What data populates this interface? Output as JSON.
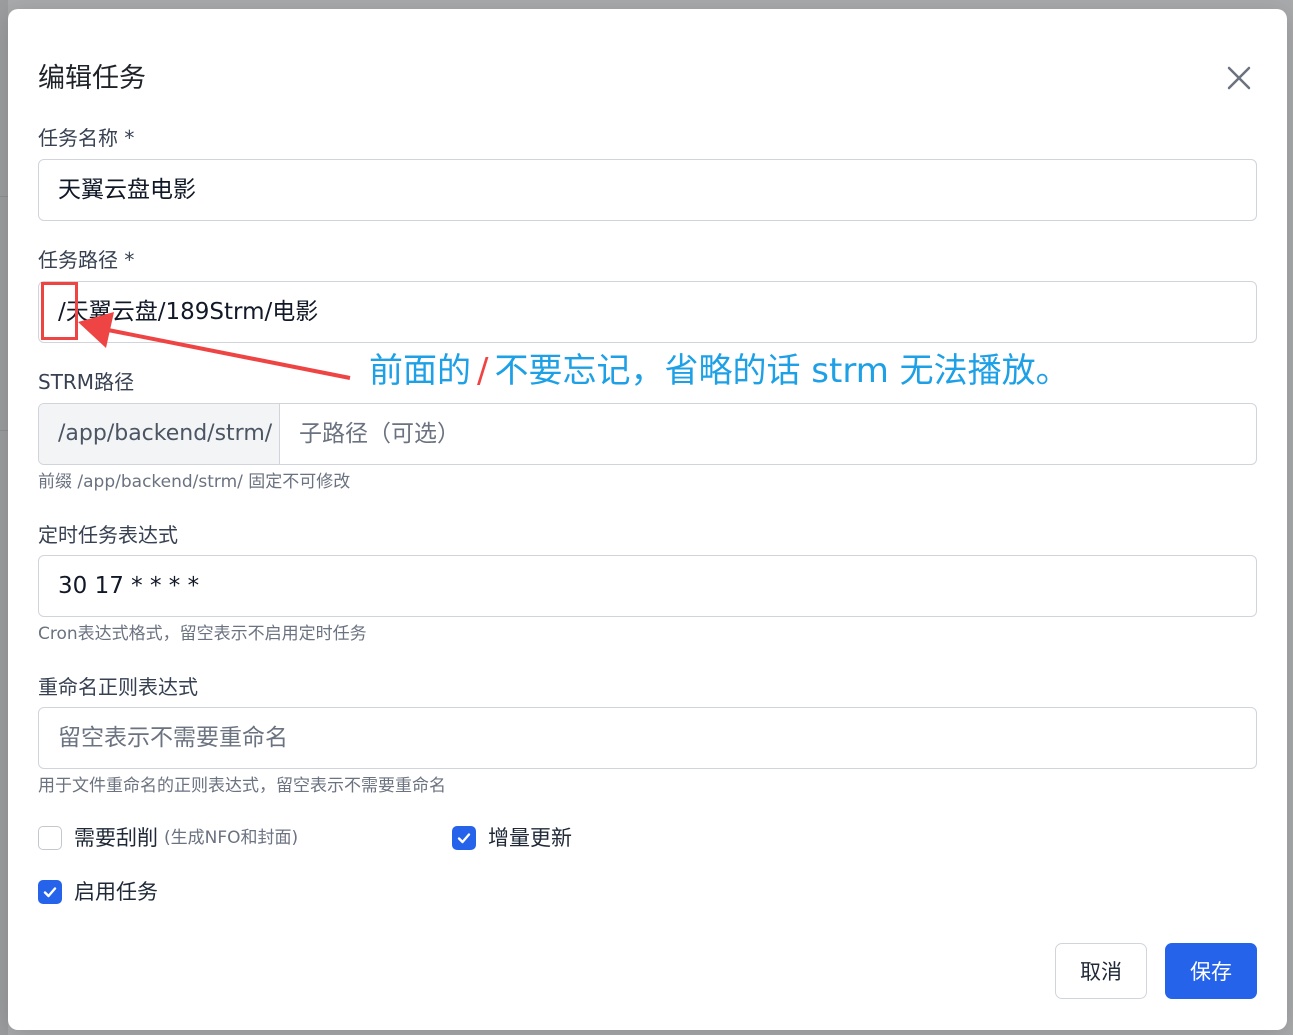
{
  "dialog": {
    "title": "编辑任务"
  },
  "fields": {
    "task_name": {
      "label": "任务名称",
      "required_mark": "*",
      "value": "天翼云盘电影"
    },
    "task_path": {
      "label": "任务路径",
      "required_mark": "*",
      "value": "/天翼云盘/189Strm/电影"
    },
    "strm_path": {
      "label": "STRM路径",
      "prefix": "/app/backend/strm/",
      "placeholder": "子路径（可选）",
      "hint": "前缀 /app/backend/strm/ 固定不可修改"
    },
    "cron": {
      "label": "定时任务表达式",
      "value": "30 17 * * * *",
      "hint": "Cron表达式格式，留空表示不启用定时任务"
    },
    "rename": {
      "label": "重命名正则表达式",
      "placeholder": "留空表示不需要重命名",
      "hint": "用于文件重命名的正则表达式，留空表示不需要重命名"
    }
  },
  "checkboxes": {
    "scrape": {
      "label": "需要刮削",
      "note": "(生成NFO和封面)",
      "checked": false
    },
    "incremental": {
      "label": "增量更新",
      "checked": true
    },
    "enable": {
      "label": "启用任务",
      "checked": true
    }
  },
  "buttons": {
    "cancel": "取消",
    "save": "保存"
  },
  "annotation": {
    "text_before": "前面的",
    "slash": "/",
    "text_after": "不要忘记，省略的话 strm 无法播放。"
  },
  "colors": {
    "primary": "#2563eb",
    "annotation_red": "#ef4444",
    "annotation_blue": "#1ea0e6"
  }
}
